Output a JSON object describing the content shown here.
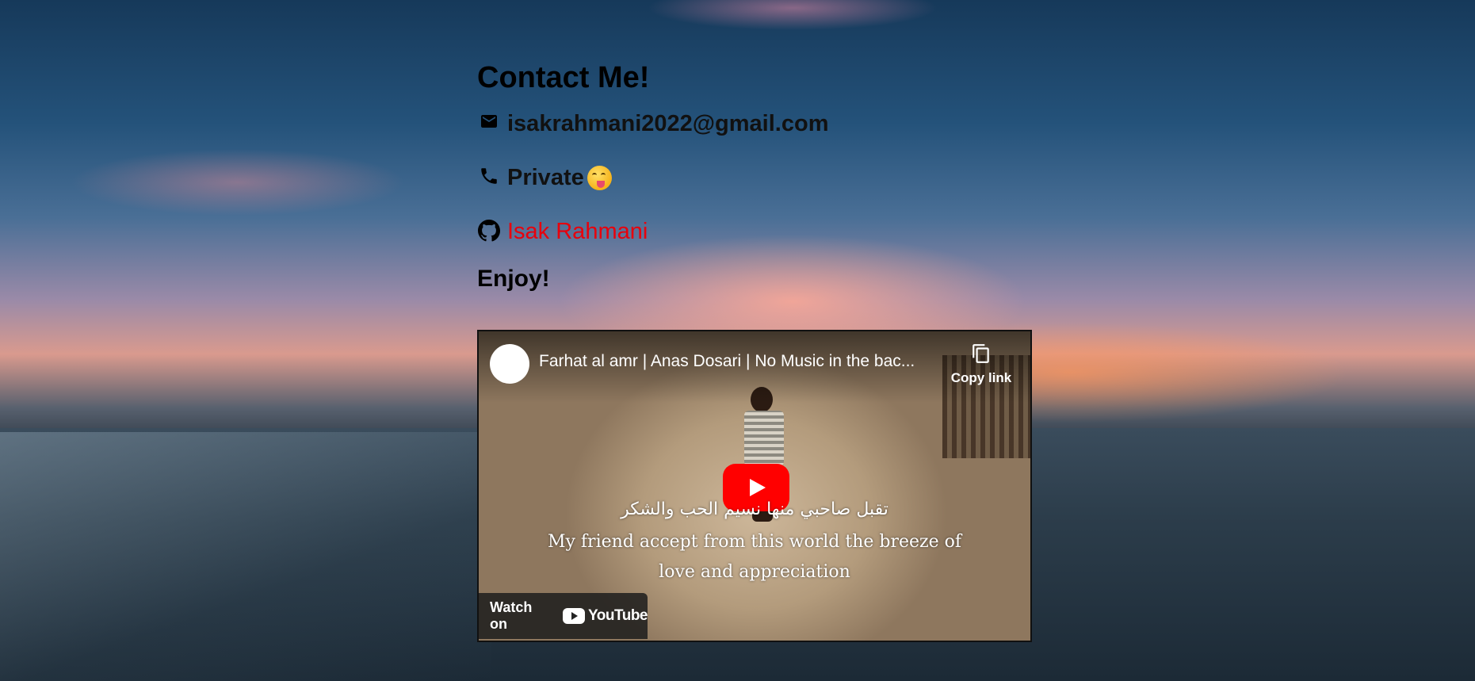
{
  "heading": "Contact Me!",
  "contacts": {
    "email": "isakrahmani2022@gmail.com",
    "phone": "Private",
    "github": "Isak Rahmani"
  },
  "enjoy": "Enjoy!",
  "video": {
    "title": "Farhat al amr | Anas Dosari | No Music in the bac...",
    "copy_link_label": "Copy link",
    "subtitle_arabic": "تقبل صاحبي منها نسيم الحب والشكر",
    "subtitle_english_line1": "My friend accept from this world the breeze of",
    "subtitle_english_line2": "love and appreciation",
    "watch_on_label": "Watch on",
    "youtube_wordmark": "YouTube"
  },
  "colors": {
    "link": "#e8000c",
    "youtube_red": "#ff0000"
  }
}
